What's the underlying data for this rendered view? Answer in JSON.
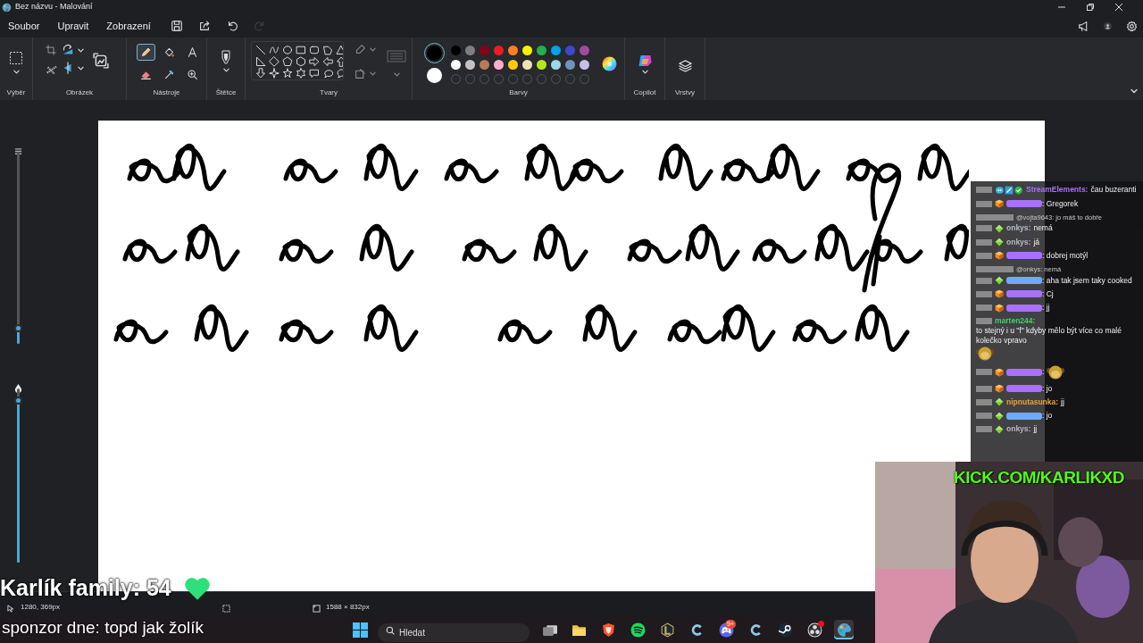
{
  "window": {
    "title": "Bez názvu - Malování"
  },
  "menu": [
    {
      "label": "Soubor"
    },
    {
      "label": "Upravit"
    },
    {
      "label": "Zobrazení"
    }
  ],
  "quick_actions": [
    {
      "kind": "save",
      "disabled": false
    },
    {
      "kind": "share",
      "disabled": false
    },
    {
      "kind": "undo",
      "disabled": false
    },
    {
      "kind": "redo",
      "disabled": true
    }
  ],
  "ribbon_groups": [
    {
      "kind": "selection",
      "label": "Výběr"
    },
    {
      "label": "Obrázek"
    },
    {
      "kind": "tools",
      "label": "Nástroje"
    },
    {
      "kind": "brushes",
      "label": "Štětce"
    },
    {
      "kind": "shapes",
      "label": "Tvary"
    },
    {
      "kind": "colors",
      "label": "Barvy"
    },
    {
      "kind": "copilot",
      "label": "Copilot"
    },
    {
      "kind": "layers",
      "label": "Vrstvy"
    }
  ],
  "tools": [
    {
      "kind": "pencil",
      "selected": true
    },
    {
      "kind": "fill",
      "selected": false
    },
    {
      "kind": "text",
      "selected": false
    },
    {
      "kind": "eraser",
      "selected": false
    },
    {
      "kind": "picker",
      "selected": false
    },
    {
      "kind": "zoom",
      "selected": false
    }
  ],
  "colors": {
    "current": [
      {
        "color": "#000000",
        "selected": true
      },
      {
        "color": "#ffffff",
        "selected": false
      }
    ],
    "swatches": [
      {
        "color": "#000000"
      },
      {
        "color": "#7f7f7f"
      },
      {
        "color": "#880015"
      },
      {
        "color": "#ed1c24"
      },
      {
        "color": "#ff7f27"
      },
      {
        "color": "#fff200"
      },
      {
        "color": "#22b14c"
      },
      {
        "color": "#00a2e8"
      },
      {
        "color": "#3f48cc"
      },
      {
        "color": "#a349a4"
      },
      {
        "color": "#ffffff"
      },
      {
        "color": "#c3c3c3"
      },
      {
        "color": "#b97a57"
      },
      {
        "color": "#ffaec9"
      },
      {
        "color": "#ffc90e"
      },
      {
        "color": "#efe4b0"
      },
      {
        "color": "#b5e61d"
      },
      {
        "color": "#99d9ea"
      },
      {
        "color": "#7092be"
      },
      {
        "color": "#c8bfe7"
      }
    ]
  },
  "sliders": [
    {
      "kind": "size",
      "level": 0.08
    },
    {
      "kind": "opacity",
      "level": 0.93
    }
  ],
  "status_bar": {
    "cursor": "1280, 369px",
    "size": "1588 × 832px"
  },
  "chat": [
    {
      "kind": "bot",
      "user": "StreamElements:",
      "color": "#a970ff",
      "text": "čau buzeranti"
    },
    {
      "kind": "cube",
      "color": "#a970ff",
      "text": ": Gregorek"
    },
    {
      "kind": "reply",
      "text": "@vojta9643: jo máš to dobře"
    },
    {
      "kind": "diamond",
      "user": "onkys:",
      "color": "#b8b8c8",
      "text": "nemá"
    },
    {
      "kind": "diamond",
      "user": "onkys:",
      "color": "#b8b8c8",
      "text": "já"
    },
    {
      "kind": "cube",
      "color": "#a970ff",
      "text": ": dobrej motýl"
    },
    {
      "kind": "reply",
      "text": "@onkys: nemá"
    },
    {
      "kind": "diamond",
      "color": "#6fa8ff",
      "text": ": aha tak jsem taky cooked"
    },
    {
      "kind": "cube",
      "color": "#a970ff",
      "text": ": Cj"
    },
    {
      "kind": "cube",
      "color": "#a970ff",
      "text": ": jj"
    },
    {
      "kind": "plain",
      "user": "marten244:",
      "color": "#3fd26b",
      "text": "to stejný i u \"f\" kdyby mělo být více co malé kolečko vpravo",
      "emote": true
    },
    {
      "kind": "cube",
      "color": "#a970ff",
      "text": ":",
      "emote": true
    },
    {
      "kind": "cube",
      "color": "#a970ff",
      "text": ": jo"
    },
    {
      "kind": "diamond",
      "user": "nipnutasunka:",
      "color": "#e8a33a",
      "text": "jj"
    },
    {
      "kind": "diamond",
      "color": "#6fa8ff",
      "text": ": jo"
    },
    {
      "kind": "diamond",
      "user": "onkys:",
      "color": "#b8b8c8",
      "text": "jj"
    }
  ],
  "overlay": {
    "followers": "Karlík family: 54",
    "sponsor": "sponzor dne: topd jak žolík",
    "channel": "KICK.COM/KARLIKXD"
  },
  "taskbar": {
    "search_placeholder": "Hledat",
    "apps": [
      {
        "kind": "taskview",
        "selected": false
      },
      {
        "kind": "folder",
        "selected": false
      },
      {
        "kind": "shield",
        "selected": false
      },
      {
        "kind": "waves",
        "selected": false
      },
      {
        "kind": "hexagon",
        "selected": false
      },
      {
        "kind": "crescent",
        "selected": false
      },
      {
        "kind": "gamepad",
        "selected": false,
        "badge": "9+"
      },
      {
        "kind": "crescent",
        "selected": false
      },
      {
        "kind": "steam",
        "selected": false
      },
      {
        "kind": "aperture",
        "selected": false,
        "dot": true
      },
      {
        "kind": "palette",
        "selected": true
      }
    ]
  }
}
